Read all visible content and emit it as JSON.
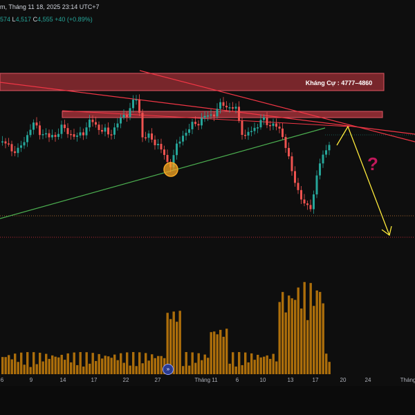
{
  "header": {
    "line1": "m, Tháng 11 18, 2025 23:14 UTC+7",
    "line2": {
      "v1": "574",
      "low_label": "L",
      "low": "4,517",
      "close_label": "C",
      "close": "4,555",
      "change": "+40 (+0.89%)"
    }
  },
  "annotations": {
    "resistance_label": "Kháng Cự : 4777–4860",
    "question_mark": "?"
  },
  "xaxis": {
    "ticks": [
      "6",
      "9",
      "14",
      "17",
      "22",
      "27",
      "Tháng 11",
      "6",
      "10",
      "13",
      "17",
      "20",
      "24",
      "Tháng"
    ]
  },
  "colors": {
    "up": "#26a69a",
    "down": "#ef5350",
    "resistance_zone": "#b2343c",
    "trendline_up": "#4caf50",
    "trendline_down": "#f23645",
    "projection": "#ffeb3b",
    "volume": "#c87f0a",
    "pivot_marker": "#f5a623"
  },
  "volume_icon": "tradingview-logo-icon"
}
